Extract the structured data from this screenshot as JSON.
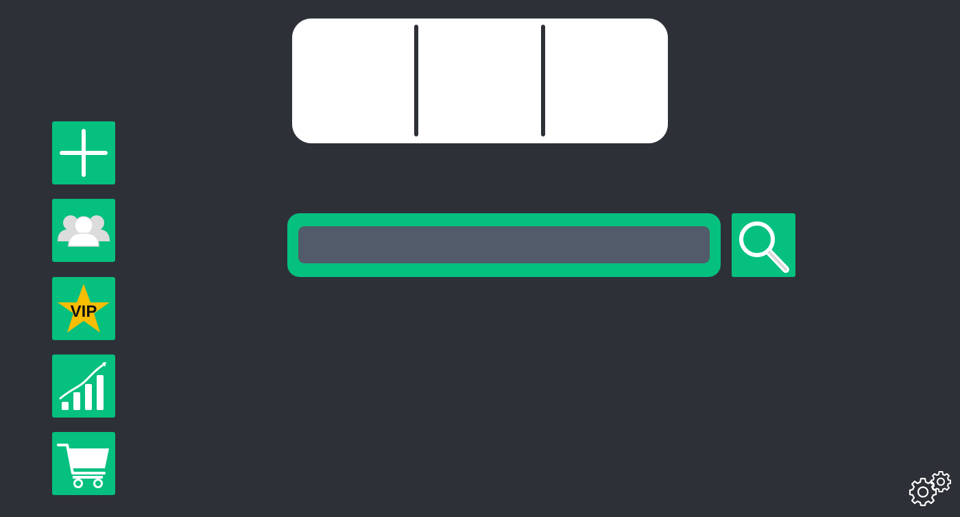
{
  "colors": {
    "background": "#2e3038",
    "accent": "#05c07f",
    "card": "#ffffff",
    "input_fill": "#525b69",
    "vip_star": "#f7bd03"
  },
  "sidebar": {
    "items": [
      {
        "name": "add",
        "icon": "plus-icon"
      },
      {
        "name": "users",
        "icon": "users-group-icon"
      },
      {
        "name": "vip",
        "icon": "vip-star-icon",
        "label": "VIP"
      },
      {
        "name": "stats",
        "icon": "growth-chart-icon"
      },
      {
        "name": "cart",
        "icon": "shopping-cart-icon"
      }
    ]
  },
  "segmented_control": {
    "segments": [
      "",
      "",
      ""
    ]
  },
  "search": {
    "value": "",
    "placeholder": "",
    "button_icon": "search-icon"
  },
  "settings": {
    "icon": "gears-icon"
  }
}
